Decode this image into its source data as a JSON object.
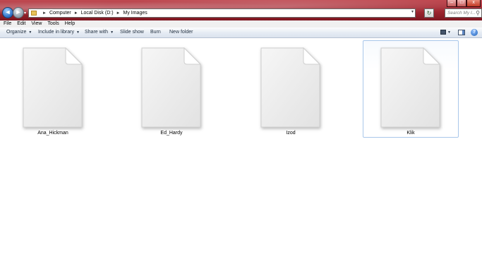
{
  "window": {
    "controls": {
      "minimize": "–",
      "maximize": "□",
      "close": "x"
    }
  },
  "navigation": {
    "back_glyph": "◄",
    "forward_glyph": "►",
    "dropdown_glyph": "▾"
  },
  "address_bar": {
    "crumbs": [
      "Computer",
      "Local Disk (D:)",
      "My Images"
    ],
    "separator": "►",
    "dropdown_glyph": "▾"
  },
  "refresh_glyph": "↻",
  "search": {
    "placeholder": "Search My I...",
    "icon": "search-icon"
  },
  "menu": [
    "File",
    "Edit",
    "View",
    "Tools",
    "Help"
  ],
  "commands": {
    "organize": "Organize",
    "include_in_library": "Include in library",
    "share_with": "Share with",
    "slide_show": "Slide show",
    "burn": "Burn",
    "new_folder": "New folder",
    "caret": "▼"
  },
  "files": [
    {
      "name": "Ana_Hickman",
      "selected": false
    },
    {
      "name": "Ed_Hardy",
      "selected": false
    },
    {
      "name": "Izod",
      "selected": false
    },
    {
      "name": "Klik",
      "selected": true
    }
  ],
  "colors": {
    "title_glass": "#9e2630",
    "selection_border": "#a9c7ea",
    "command_bar": "#e6ecf4"
  }
}
